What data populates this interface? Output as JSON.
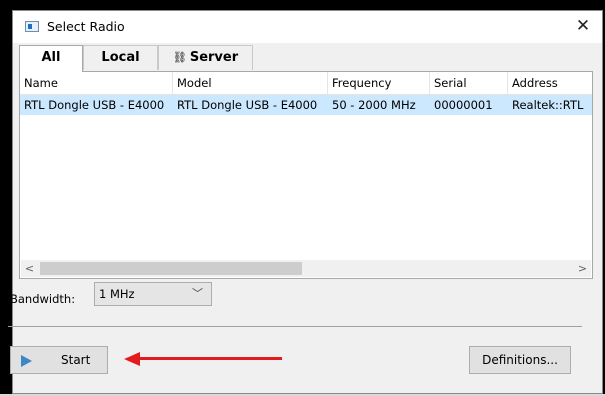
{
  "window": {
    "title": "Select Radio",
    "close_glyph": "✕"
  },
  "tabs": [
    {
      "label": "All",
      "active": true
    },
    {
      "label": "Local",
      "active": false
    },
    {
      "label": "Server",
      "active": false,
      "icon": "network-icon"
    }
  ],
  "table": {
    "columns": [
      "Name",
      "Model",
      "Frequency",
      "Serial",
      "Address"
    ],
    "rows": [
      {
        "name": "RTL Dongle USB - E4000",
        "model": "RTL Dongle USB - E4000",
        "frequency": "50 - 2000 MHz",
        "serial": "00000001",
        "address": "Realtek::RTL"
      }
    ],
    "selection_color": "#cce8ff",
    "scroll_left_glyph": "<",
    "scroll_right_glyph": ">"
  },
  "bandwidth": {
    "label": "Bandwidth:",
    "value": "1 MHz"
  },
  "buttons": {
    "start": "Start",
    "definitions": "Definitions..."
  },
  "colors": {
    "accent_arrow": "#e21c1c",
    "play_icon": "#3d87c4"
  }
}
